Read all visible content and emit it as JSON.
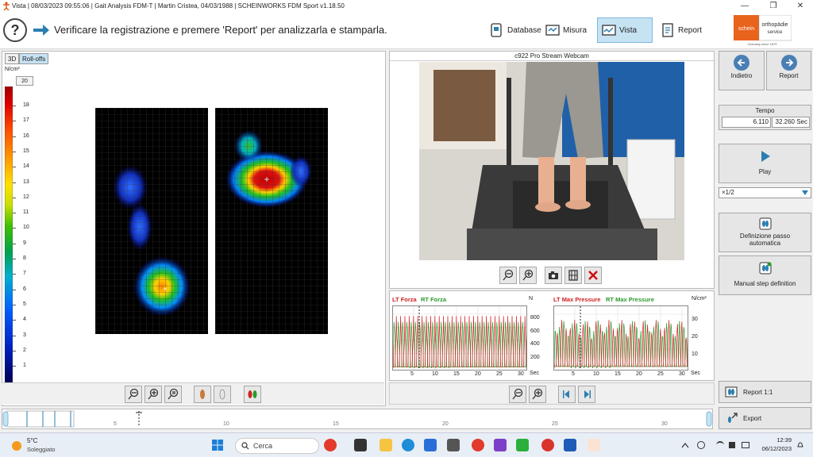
{
  "window": {
    "title": "Vista | 08/03/2023 09:55:06 | Gait Analysis FDM-T | Martin Cristea, 04/03/1988 | SCHEINWORKS FDM Sport v1.18.50"
  },
  "toolbar": {
    "instruction": "Verificare la registrazione e premere 'Report' per analizzarla e stamparla.",
    "database_label": "Database",
    "misura_label": "Misura",
    "vista_label": "Vista",
    "report_label": "Report"
  },
  "logo": {
    "brand_left": "schein",
    "brand_right_line1": "orthopädie",
    "brand_right_line2": "service",
    "tagline": "Germany since 1879"
  },
  "left_panel": {
    "tabs": [
      {
        "label": "3D"
      },
      {
        "label": "Roll-offs"
      }
    ],
    "unit": "N/cm²",
    "max_value": "20",
    "scale_labels": [
      "18",
      "17",
      "16",
      "15",
      "14",
      "13",
      "12",
      "11",
      "10",
      "9",
      "8",
      "7",
      "6",
      "5",
      "4",
      "3",
      "2",
      "1"
    ]
  },
  "camera": {
    "title": "c922 Pro Stream Webcam"
  },
  "graphs": {
    "force": {
      "title_lt": "LT Forza",
      "title_rt": "RT Forza",
      "unit": "N",
      "y_ticks": [
        "800",
        "600",
        "400",
        "200"
      ],
      "x_ticks": [
        "5",
        "10",
        "15",
        "20",
        "25",
        "30"
      ],
      "x_unit": "Sec"
    },
    "pressure": {
      "title_lt": "LT Max Pressure",
      "title_rt": "RT Max Pressure",
      "unit": "N/cm²",
      "y_ticks": [
        "30",
        "20",
        "10"
      ],
      "x_ticks": [
        "5",
        "10",
        "15",
        "20",
        "25",
        "30"
      ],
      "x_unit": "Sec"
    }
  },
  "right_panel": {
    "back_label": "Indietro",
    "report_label": "Report",
    "tempo_label": "Tempo",
    "tempo_current": "6.110",
    "tempo_total": "32.260 Sec",
    "play_label": "Play",
    "speed_value": "×1/2",
    "auto_step_label_1": "Definizione passo",
    "auto_step_label_2": "automatica",
    "manual_step_label": "Manual step definition",
    "report11_label": "Report 1:1",
    "export_label": "Export"
  },
  "timeline": {
    "labels": [
      "5",
      "10",
      "15",
      "20",
      "25",
      "30"
    ]
  },
  "taskbar": {
    "temperature": "5°C",
    "condition": "Soleggiato",
    "search_placeholder": "Cerca",
    "time": "12:39",
    "date": "06/12/2023"
  },
  "colors": {
    "accent": "#c6e3f4",
    "lt_series": "#d02020",
    "rt_series": "#2a9a2a",
    "button_blue": "#4a7fb5"
  }
}
